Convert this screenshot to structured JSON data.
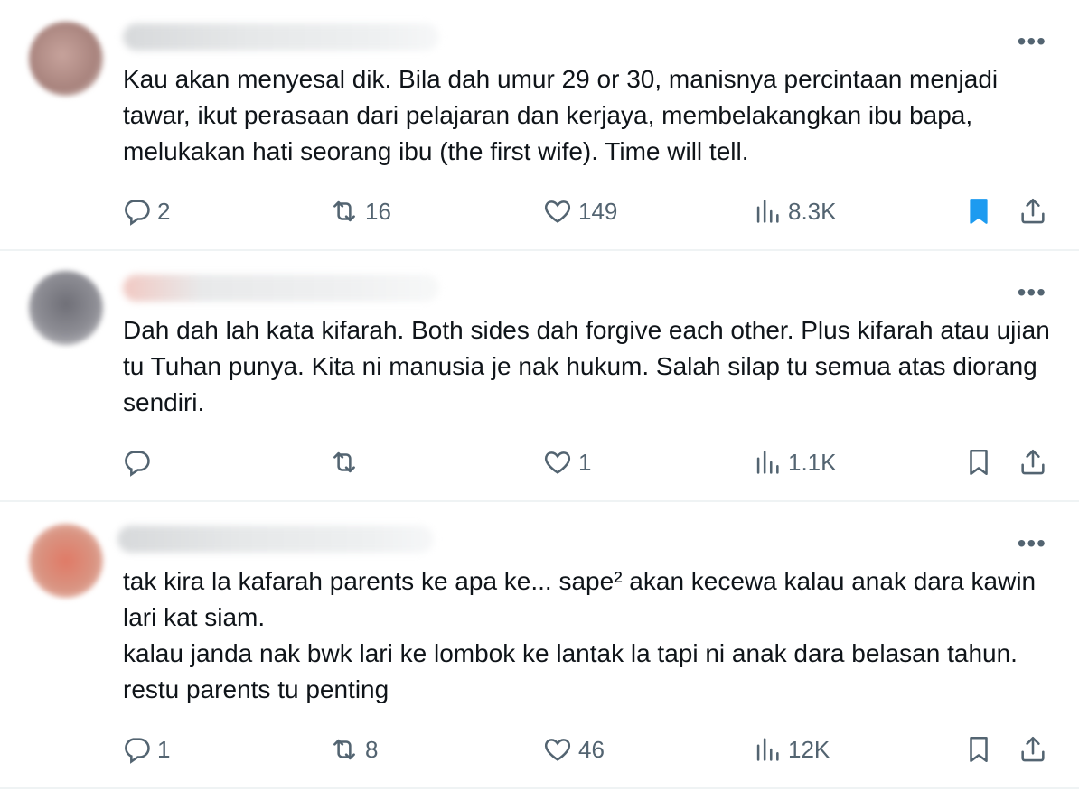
{
  "tweets": [
    {
      "more_label": "•••",
      "text": "Kau akan menyesal dik. Bila dah umur 29 or 30, manisnya percintaan menjadi tawar, ikut perasaan dari pelajaran dan kerjaya, membelakangkan ibu bapa, melukakan hati seorang ibu (the first wife). Time will tell.",
      "avatar_color": "#b58f88",
      "replies": "2",
      "retweets": "16",
      "likes": "149",
      "views": "8.3K",
      "bookmarked": true
    },
    {
      "more_label": "•••",
      "text": "Dah dah lah kata kifarah. Both sides dah forgive each other. Plus kifarah atau ujian tu Tuhan punya. Kita ni manusia je nak hukum. Salah silap tu semua atas diorang sendiri.",
      "avatar_color": "#7f7f86",
      "replies": "",
      "retweets": "",
      "likes": "1",
      "views": "1.1K",
      "bookmarked": false
    },
    {
      "more_label": "•••",
      "text": "tak kira la kafarah parents ke apa ke... sape² akan kecewa kalau anak dara kawin lari kat siam.\nkalau janda nak bwk lari ke lombok ke lantak la tapi ni anak dara belasan tahun. restu parents tu penting",
      "avatar_color": "#d9806f",
      "replies": "1",
      "retweets": "8",
      "likes": "46",
      "views": "12K",
      "bookmarked": false
    }
  ],
  "colors": {
    "icon": "#536471",
    "bookmark_active": "#1d9bf0",
    "divider": "#eff3f4"
  }
}
